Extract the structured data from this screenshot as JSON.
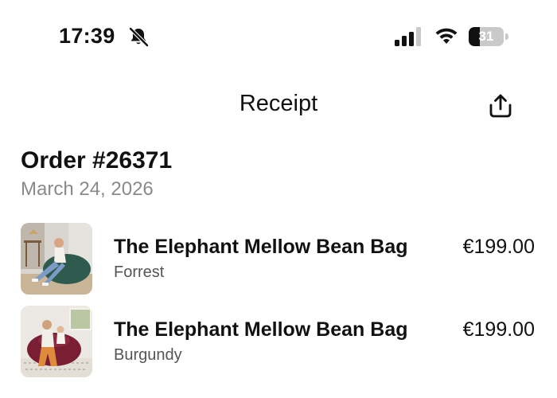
{
  "status_bar": {
    "time": "17:39",
    "battery_level": "31",
    "battery_fraction": 0.31,
    "icons": [
      "bell-slash-icon",
      "cellular-signal-icon",
      "wifi-icon",
      "battery-icon"
    ]
  },
  "nav": {
    "title": "Receipt",
    "share_icon": "share-icon"
  },
  "order": {
    "title": "Order #26371",
    "date": "March 24, 2026"
  },
  "items": [
    {
      "name": "The Elephant Mellow Bean Bag",
      "variant": "Forrest",
      "price": "€199.00",
      "color": "#2f5a4e"
    },
    {
      "name": "The Elephant Mellow Bean Bag",
      "variant": "Burgundy",
      "price": "€199.00",
      "color": "#7a1f33"
    }
  ]
}
